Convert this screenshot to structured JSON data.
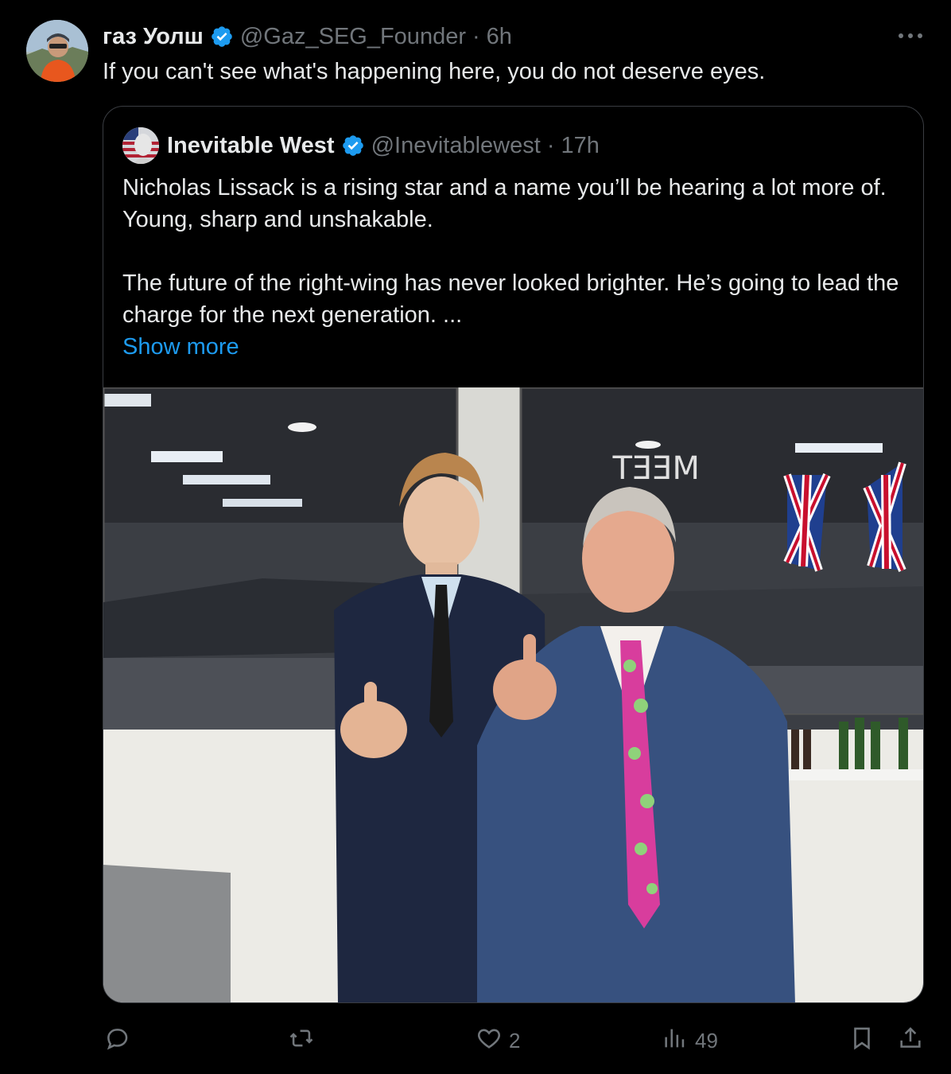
{
  "post": {
    "author_name": "газ Уолш",
    "author_handle": "@Gaz_SEG_Founder",
    "separator": "·",
    "time": "6h",
    "text": "If you can't see what's happening here, you do not deserve eyes."
  },
  "quoted": {
    "author_name": "Inevitable West",
    "author_handle": "@Inevitablewest",
    "separator": "·",
    "time": "17h",
    "paragraph1": "Nicholas Lissack is a rising star and a name you’ll be hearing a lot more of. Young, sharp and unshakable.",
    "paragraph2": "The future of the right-wing has never looked brighter. He’s going to lead the charge for the next generation. ...",
    "show_more": "Show more",
    "photo_sign": "MEET"
  },
  "actions": {
    "replies": "",
    "reposts": "",
    "likes": "2",
    "views": "49"
  },
  "colors": {
    "background": "#000000",
    "text": "#e7e9ea",
    "muted": "#71767b",
    "accent": "#1d9bf0",
    "border": "#3a3d42"
  },
  "icons": [
    "verified-badge-icon",
    "more-icon",
    "reply-icon",
    "repost-icon",
    "like-icon",
    "views-icon",
    "bookmark-icon",
    "share-icon"
  ]
}
